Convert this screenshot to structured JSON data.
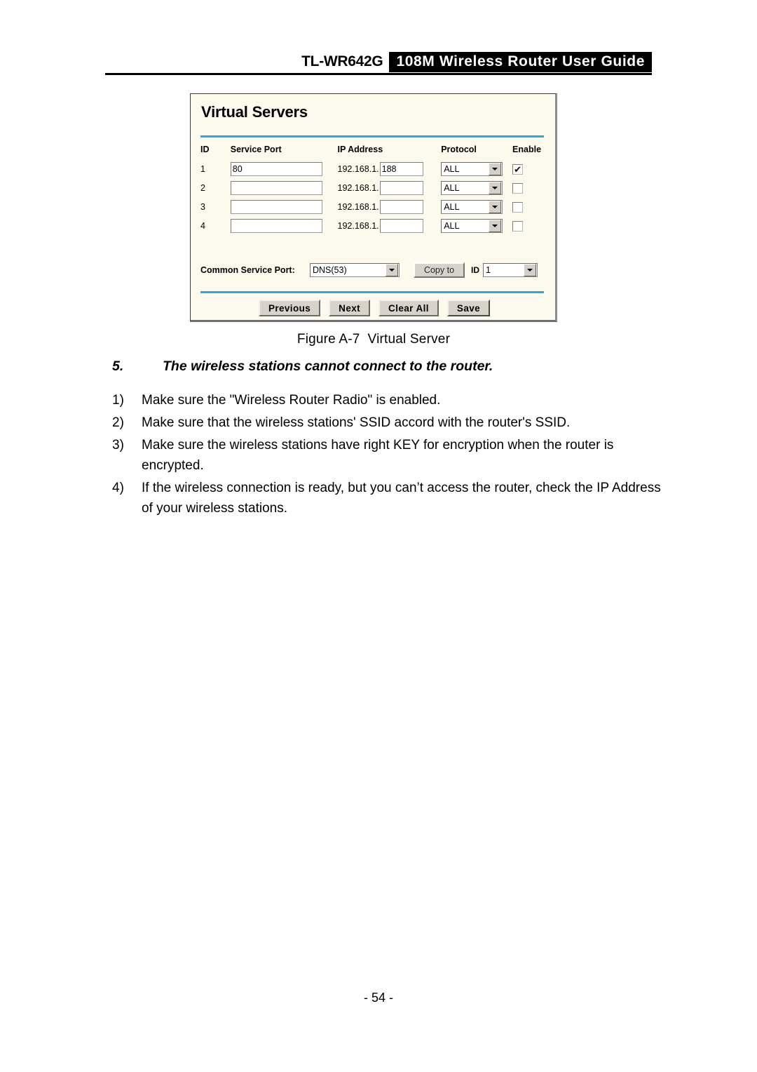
{
  "header": {
    "model": "TL-WR642G",
    "guide_title": "108M Wireless Router User Guide"
  },
  "panel": {
    "title": "Virtual Servers",
    "columns": {
      "id": "ID",
      "service_port": "Service Port",
      "ip_address": "IP Address",
      "protocol": "Protocol",
      "enable": "Enable"
    },
    "ip_prefix": "192.168.1.",
    "rows": [
      {
        "id": "1",
        "service_port": "80",
        "ip_suffix": "188",
        "protocol": "ALL",
        "enabled": true,
        "check_glyph": "✔"
      },
      {
        "id": "2",
        "service_port": "",
        "ip_suffix": "",
        "protocol": "ALL",
        "enabled": false,
        "check_glyph": ""
      },
      {
        "id": "3",
        "service_port": "",
        "ip_suffix": "",
        "protocol": "ALL",
        "enabled": false,
        "check_glyph": ""
      },
      {
        "id": "4",
        "service_port": "",
        "ip_suffix": "",
        "protocol": "ALL",
        "enabled": false,
        "check_glyph": ""
      }
    ],
    "common_service_port": {
      "label": "Common Service Port:",
      "selected": "DNS(53)",
      "copy_to_label": "Copy to",
      "id_label": "ID",
      "id_selected": "1"
    },
    "buttons": {
      "previous": "Previous",
      "next": "Next",
      "clear_all": "Clear All",
      "save": "Save"
    },
    "colors": {
      "panel_background": "#fbfaec",
      "divider": "#29a8dd",
      "button_face": "#d7d3ca"
    }
  },
  "figure": {
    "label": "Figure A-7",
    "caption": "Virtual Server"
  },
  "section": {
    "number": "5.",
    "title": "The wireless stations cannot connect to the router."
  },
  "steps": [
    {
      "marker": "1)",
      "text": "Make sure the \"Wireless Router Radio\" is enabled."
    },
    {
      "marker": "2)",
      "text": "Make sure that the wireless stations' SSID accord with the router's SSID."
    },
    {
      "marker": "3)",
      "text": "Make sure the wireless stations have right KEY for encryption when the router is encrypted."
    },
    {
      "marker": "4)",
      "text": "If the wireless connection is ready, but you can’t access the router, check the IP Address of your wireless stations."
    }
  ],
  "footer": {
    "page_number": "- 54 -"
  }
}
